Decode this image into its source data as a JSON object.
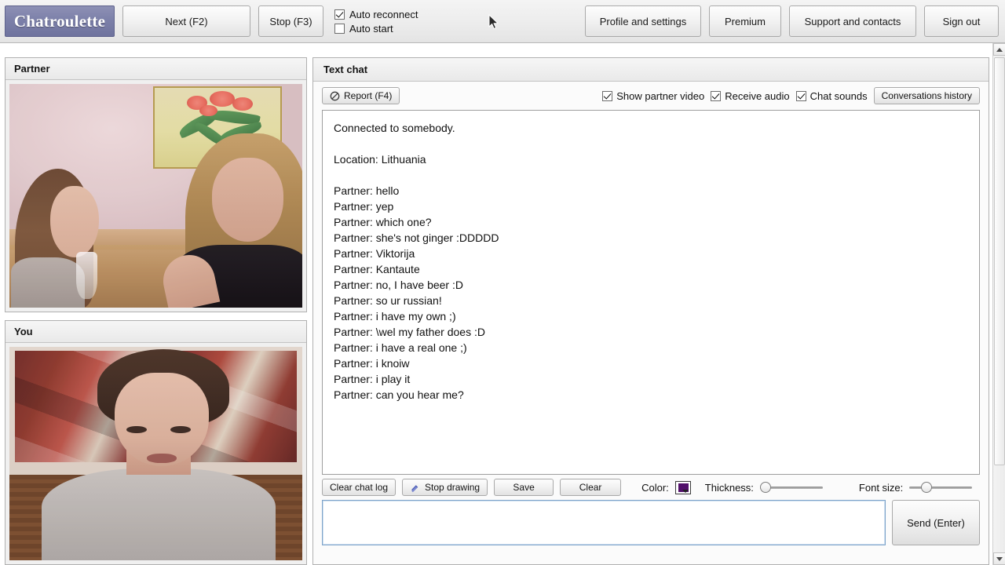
{
  "toolbar": {
    "logo": "Chatroulette",
    "next_label": "Next (F2)",
    "stop_label": "Stop (F3)",
    "auto_reconnect_label": "Auto reconnect",
    "auto_reconnect_checked": true,
    "auto_start_label": "Auto start",
    "auto_start_checked": false,
    "profile_label": "Profile and settings",
    "premium_label": "Premium",
    "support_label": "Support and contacts",
    "signout_label": "Sign out"
  },
  "video": {
    "partner_title": "Partner",
    "you_title": "You"
  },
  "chat": {
    "title": "Text chat",
    "report_label": "Report (F4)",
    "show_partner_video_label": "Show partner video",
    "show_partner_video_checked": true,
    "receive_audio_label": "Receive audio",
    "receive_audio_checked": true,
    "chat_sounds_label": "Chat sounds",
    "chat_sounds_checked": true,
    "conversations_history_label": "Conversations history",
    "log": [
      "Connected to somebody.",
      "",
      "Location: Lithuania",
      "",
      "Partner: hello",
      "Partner: yep",
      "Partner: which one?",
      "Partner: she's not ginger :DDDDD",
      "Partner: Viktorija",
      "Partner: Kantaute",
      "Partner: no, I have beer :D",
      "Partner: so ur russian!",
      "Partner: i have my own ;)",
      "Partner: \\wel my father does :D",
      "Partner: i have a real one ;)",
      "Partner: i knoiw",
      "Partner: i play it",
      "Partner: can you hear me?"
    ]
  },
  "drawing": {
    "clear_chat_log_label": "Clear chat log",
    "stop_drawing_label": "Stop drawing",
    "save_label": "Save",
    "clear_label": "Clear",
    "color_label": "Color:",
    "color_value": "#52106B",
    "thickness_label": "Thickness:",
    "thickness_percent": 0,
    "font_size_label": "Font size:",
    "font_size_percent": 22
  },
  "compose": {
    "message_value": "",
    "message_placeholder": "",
    "send_label": "Send (Enter)"
  },
  "icons": {
    "report": "prohibition-icon",
    "pencil": "pencil-stroke-icon",
    "cursor": "mouse-pointer-icon"
  }
}
